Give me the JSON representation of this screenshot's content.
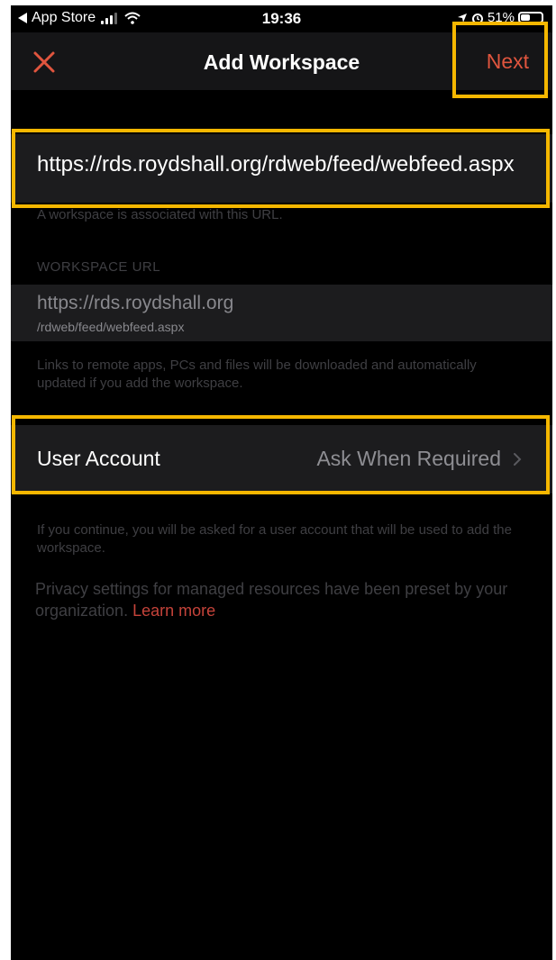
{
  "status_bar": {
    "back_app": "App Store",
    "time": "19:36",
    "battery_percent": "51%",
    "battery_level": 0.51
  },
  "nav": {
    "title": "Add Workspace",
    "next_label": "Next"
  },
  "workspace": {
    "url_input_value": "https://rds.roydshall.org/rdweb/feed/webfeed.aspx",
    "url_association_note": "A workspace is associated with this URL.",
    "section_header": "WORKSPACE URL",
    "url_host": "https://rds.roydshall.org",
    "url_path": "/rdweb/feed/webfeed.aspx",
    "links_note": "Links to remote apps, PCs and files will be downloaded and automatically updated if you add the workspace."
  },
  "user_account": {
    "label": "User Account",
    "value": "Ask When Required"
  },
  "notes": {
    "continue_note": "If you continue, you will be asked for a user account that will be used to add the workspace.",
    "privacy_text": "Privacy settings for managed resources have been preset by your organization.",
    "learn_more": "Learn more"
  },
  "colors": {
    "accent": "#e0553e",
    "highlight": "#f5b700",
    "background": "#000000",
    "cell": "#1c1c1e"
  }
}
